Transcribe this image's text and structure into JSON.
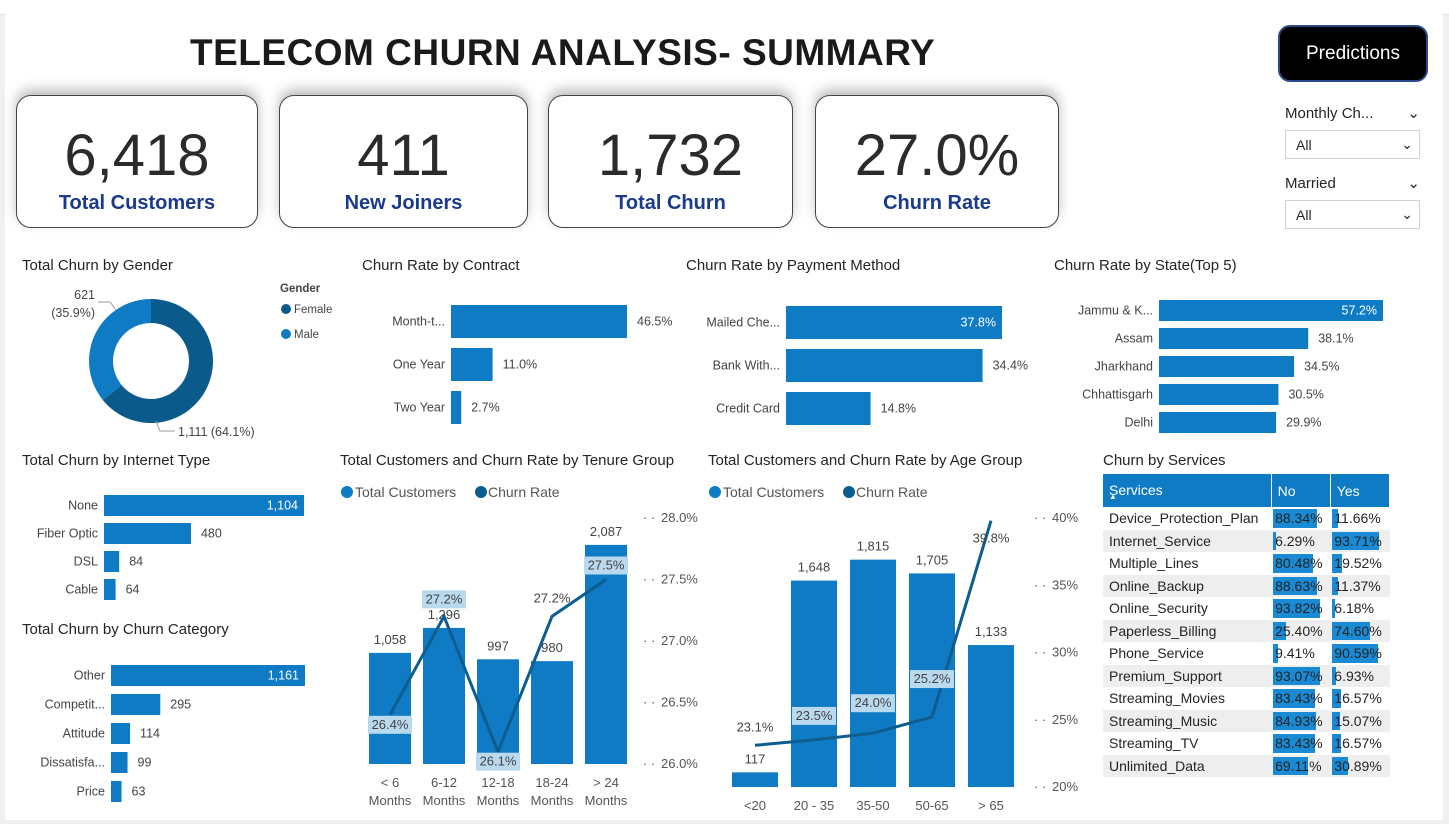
{
  "header": {
    "title": "TELECOM CHURN ANALYSIS- SUMMARY",
    "predictions_label": "Predictions"
  },
  "kpis": [
    {
      "value": "6,418",
      "label": "Total Customers"
    },
    {
      "value": "411",
      "label": "New Joiners"
    },
    {
      "value": "1,732",
      "label": "Total Churn"
    },
    {
      "value": "27.0%",
      "label": "Churn Rate"
    }
  ],
  "slicers": [
    {
      "label": "Monthly Ch...",
      "value": "All"
    },
    {
      "label": "Married",
      "value": "All"
    }
  ],
  "colors": {
    "accent": "#0f7bc4",
    "dark": "#0b5a8c",
    "line": "#0d5d8f",
    "kpi_label": "#1a3a8a"
  },
  "chart_data": [
    {
      "id": "gender",
      "type": "pie",
      "title": "Total Churn by Gender",
      "legend_title": "Gender",
      "labels": [
        "Female",
        "Male"
      ],
      "values": [
        1111,
        621
      ],
      "percent_labels": [
        "1,111 (64.1%)",
        "621\n(35.9%)"
      ]
    },
    {
      "id": "contract",
      "type": "bar",
      "title": "Churn Rate by Contract",
      "categories": [
        "Month-t...",
        "One Year",
        "Two Year"
      ],
      "values": [
        46.5,
        11.0,
        2.7
      ],
      "labels": [
        "46.5%",
        "11.0%",
        "2.7%"
      ]
    },
    {
      "id": "payment",
      "type": "bar",
      "title": "Churn Rate by Payment Method",
      "categories": [
        "Mailed Che...",
        "Bank With...",
        "Credit Card"
      ],
      "values": [
        37.8,
        34.4,
        14.8
      ],
      "labels": [
        "37.8%",
        "34.4%",
        "14.8%"
      ]
    },
    {
      "id": "state",
      "type": "bar",
      "title": "Churn Rate by State(Top 5)",
      "categories": [
        "Jammu & K...",
        "Assam",
        "Jharkhand",
        "Chhattisgarh",
        "Delhi"
      ],
      "values": [
        57.2,
        38.1,
        34.5,
        30.5,
        29.9
      ],
      "labels": [
        "57.2%",
        "38.1%",
        "34.5%",
        "30.5%",
        "29.9%"
      ]
    },
    {
      "id": "internet",
      "type": "bar",
      "title": "Total Churn by Internet Type",
      "categories": [
        "None",
        "Fiber Optic",
        "DSL",
        "Cable"
      ],
      "values": [
        1104,
        480,
        84,
        64
      ],
      "labels": [
        "1,104",
        "480",
        "84",
        "64"
      ]
    },
    {
      "id": "category",
      "type": "bar",
      "title": "Total Churn by Churn Category",
      "categories": [
        "Other",
        "Competit...",
        "Attitude",
        "Dissatisfa...",
        "Price"
      ],
      "values": [
        1161,
        295,
        114,
        99,
        63
      ],
      "labels": [
        "1,161",
        "295",
        "114",
        "99",
        "63"
      ]
    },
    {
      "id": "tenure",
      "type": "bar",
      "title": "Total Customers and Churn Rate by Tenure Group",
      "legend": [
        "Total Customers",
        "Churn Rate"
      ],
      "categories": [
        "< 6\nMonths",
        "6-12\nMonths",
        "12-18\nMonths",
        "18-24\nMonths",
        "> 24\nMonths"
      ],
      "series": [
        {
          "name": "Total Customers",
          "values": [
            1058,
            1296,
            997,
            980,
            2087
          ],
          "labels": [
            "1,058",
            "1,296",
            "997",
            "980",
            "2,087"
          ]
        },
        {
          "name": "Churn Rate",
          "values": [
            26.4,
            27.2,
            26.1,
            27.2,
            27.5
          ],
          "labels": [
            "26.4%",
            "27.2%",
            "26.1%",
            "27.2%",
            "27.5%"
          ]
        }
      ],
      "y2_ticks": [
        "28.0%",
        "27.5%",
        "27.0%",
        "26.5%",
        "26.0%"
      ],
      "y2lim": [
        26.0,
        28.0
      ],
      "ylim": [
        0,
        2200
      ]
    },
    {
      "id": "age",
      "type": "bar",
      "title": "Total Customers and Churn Rate by Age Group",
      "legend": [
        "Total Customers",
        "Churn Rate"
      ],
      "categories": [
        "<20",
        "20 - 35",
        "35-50",
        "50-65",
        "> 65"
      ],
      "series": [
        {
          "name": "Total Customers",
          "values": [
            117,
            1648,
            1815,
            1705,
            1133
          ],
          "labels": [
            "117",
            "1,648",
            "1,815",
            "1,705",
            "1,133"
          ]
        },
        {
          "name": "Churn Rate",
          "values": [
            23.1,
            23.5,
            24.0,
            25.2,
            39.8
          ],
          "labels": [
            "23.1%",
            "23.5%",
            "24.0%",
            "25.2%",
            "39.8%"
          ]
        }
      ],
      "y2_ticks": [
        "40%",
        "35%",
        "30%",
        "25%",
        "20%"
      ],
      "y2lim": [
        20,
        40
      ],
      "ylim": [
        0,
        1900
      ]
    },
    {
      "id": "services",
      "type": "table",
      "title": "Churn by Services",
      "columns": [
        "Services",
        "No",
        "Yes"
      ],
      "rows": [
        [
          "Device_Protection_Plan",
          "88.34%",
          "11.66%"
        ],
        [
          "Internet_Service",
          "6.29%",
          "93.71%"
        ],
        [
          "Multiple_Lines",
          "80.48%",
          "19.52%"
        ],
        [
          "Online_Backup",
          "88.63%",
          "11.37%"
        ],
        [
          "Online_Security",
          "93.82%",
          "6.18%"
        ],
        [
          "Paperless_Billing",
          "25.40%",
          "74.60%"
        ],
        [
          "Phone_Service",
          "9.41%",
          "90.59%"
        ],
        [
          "Premium_Support",
          "93.07%",
          "6.93%"
        ],
        [
          "Streaming_Movies",
          "83.43%",
          "16.57%"
        ],
        [
          "Streaming_Music",
          "84.93%",
          "15.07%"
        ],
        [
          "Streaming_TV",
          "83.43%",
          "16.57%"
        ],
        [
          "Unlimited_Data",
          "69.11%",
          "30.89%"
        ]
      ]
    }
  ]
}
